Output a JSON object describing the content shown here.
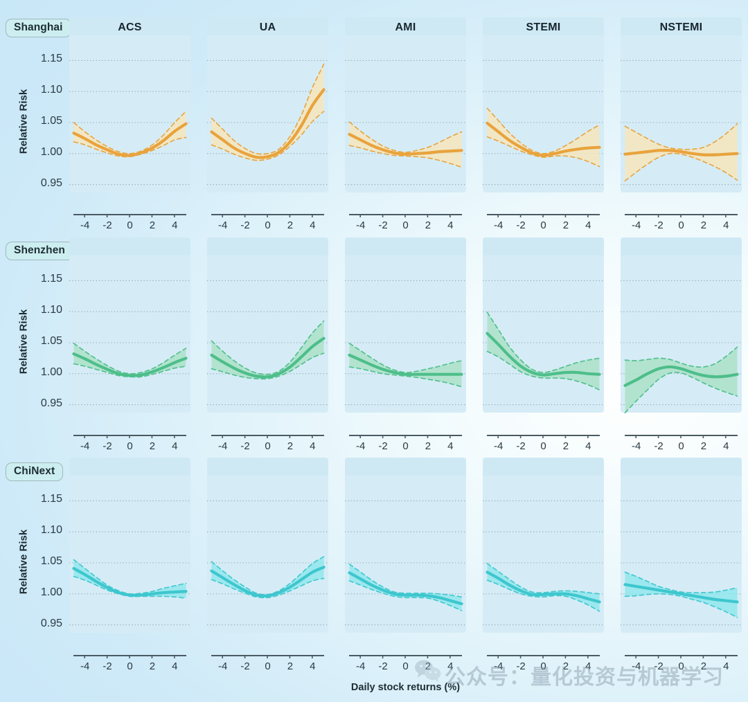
{
  "figure": {
    "xlabel": "Daily stock returns (%)",
    "ylabel": "Relative Risk",
    "watermark_text": "公众号：量化投资与机器学习",
    "watermark_icon": "wechat-icon"
  },
  "rows": [
    {
      "label": "Shanghai",
      "color": "#e8a33d",
      "band": "#f7e5ba"
    },
    {
      "label": "Shenzhen",
      "color": "#4dbe8a",
      "band": "#a9e0c6"
    },
    {
      "label": "ChiNext",
      "color": "#3ec6ce",
      "band": "#8de6ec"
    }
  ],
  "columns": [
    "ACS",
    "UA",
    "AMI",
    "STEMI",
    "NSTEMI"
  ],
  "axes": {
    "yticks": [
      "1.15",
      "1.10",
      "1.05",
      "1.00",
      "0.95"
    ],
    "ytick_values": [
      1.15,
      1.1,
      1.05,
      1.0,
      0.95
    ],
    "ylim": [
      0.925,
      1.175
    ],
    "xticks": [
      "-4",
      "-2",
      "0",
      "2",
      "4"
    ],
    "xtick_values": [
      -4,
      -2,
      0,
      2,
      4
    ],
    "xlim": [
      -5.4,
      5.4
    ],
    "grid": "horizontal-dotted"
  },
  "chart_data": {
    "type": "line",
    "title": "",
    "xlabel": "Daily stock returns (%)",
    "ylabel": "Relative Risk",
    "xlim": [
      -5.4,
      5.4
    ],
    "ylim": [
      0.925,
      1.175
    ],
    "row_facets": [
      "Shanghai",
      "Shenzhen",
      "ChiNext"
    ],
    "col_facets": [
      "ACS",
      "UA",
      "AMI",
      "STEMI",
      "NSTEMI"
    ],
    "x": [
      -5.0,
      -4.0,
      -3.0,
      -2.0,
      -1.0,
      0.0,
      1.0,
      2.0,
      3.0,
      4.0,
      5.0
    ],
    "panels": [
      {
        "row": "Shanghai",
        "col": "ACS",
        "color": "#e8a33d",
        "fit": [
          1.033,
          1.024,
          1.014,
          1.006,
          0.999,
          0.997,
          1.001,
          1.009,
          1.021,
          1.036,
          1.048
        ],
        "lower": [
          1.019,
          1.014,
          1.007,
          1.001,
          0.996,
          0.995,
          0.999,
          1.005,
          1.013,
          1.022,
          1.026
        ],
        "upper": [
          1.05,
          1.035,
          1.022,
          1.011,
          1.003,
          1.0,
          1.004,
          1.014,
          1.03,
          1.05,
          1.068
        ]
      },
      {
        "row": "Shanghai",
        "col": "UA",
        "color": "#e8a33d",
        "fit": [
          1.035,
          1.022,
          1.009,
          1.0,
          0.994,
          0.995,
          1.002,
          1.019,
          1.045,
          1.078,
          1.103
        ],
        "lower": [
          1.014,
          1.007,
          0.999,
          0.993,
          0.989,
          0.991,
          0.998,
          1.012,
          1.03,
          1.052,
          1.068
        ],
        "upper": [
          1.057,
          1.039,
          1.021,
          1.008,
          1.0,
          1.0,
          1.007,
          1.028,
          1.062,
          1.107,
          1.144
        ]
      },
      {
        "row": "Shanghai",
        "col": "AMI",
        "color": "#e8a33d",
        "fit": [
          1.031,
          1.022,
          1.013,
          1.006,
          1.001,
          0.999,
          1.0,
          1.001,
          1.003,
          1.004,
          1.005
        ],
        "lower": [
          1.013,
          1.009,
          1.004,
          1.0,
          0.997,
          0.996,
          0.995,
          0.993,
          0.989,
          0.984,
          0.978
        ],
        "upper": [
          1.051,
          1.036,
          1.023,
          1.012,
          1.005,
          1.002,
          1.005,
          1.01,
          1.018,
          1.027,
          1.035
        ]
      },
      {
        "row": "Shanghai",
        "col": "STEMI",
        "color": "#e8a33d",
        "fit": [
          1.049,
          1.035,
          1.021,
          1.01,
          1.001,
          0.997,
          1.0,
          1.004,
          1.007,
          1.009,
          1.01
        ],
        "lower": [
          1.027,
          1.02,
          1.012,
          1.004,
          0.998,
          0.994,
          0.996,
          0.996,
          0.993,
          0.987,
          0.979
        ],
        "upper": [
          1.073,
          1.053,
          1.033,
          1.017,
          1.005,
          1.0,
          1.004,
          1.013,
          1.024,
          1.036,
          1.046
        ]
      },
      {
        "row": "Shanghai",
        "col": "NSTEMI",
        "color": "#e8a33d",
        "fit": [
          0.999,
          1.001,
          1.003,
          1.005,
          1.005,
          1.003,
          1.0,
          0.998,
          0.998,
          0.999,
          1.0
        ],
        "lower": [
          0.956,
          0.97,
          0.983,
          0.994,
          1.0,
          0.999,
          0.994,
          0.987,
          0.979,
          0.969,
          0.957
        ],
        "upper": [
          1.044,
          1.034,
          1.024,
          1.015,
          1.009,
          1.007,
          1.007,
          1.01,
          1.019,
          1.032,
          1.048
        ]
      },
      {
        "row": "Shenzhen",
        "col": "ACS",
        "color": "#4dbe8a",
        "fit": [
          1.032,
          1.024,
          1.015,
          1.007,
          1.0,
          0.997,
          0.998,
          1.003,
          1.01,
          1.018,
          1.025
        ],
        "lower": [
          1.016,
          1.012,
          1.007,
          1.002,
          0.997,
          0.995,
          0.995,
          0.999,
          1.004,
          1.009,
          1.012
        ],
        "upper": [
          1.049,
          1.036,
          1.024,
          1.013,
          1.004,
          1.0,
          1.002,
          1.008,
          1.018,
          1.03,
          1.041
        ]
      },
      {
        "row": "Shenzhen",
        "col": "UA",
        "color": "#4dbe8a",
        "fit": [
          1.03,
          1.019,
          1.009,
          1.001,
          0.996,
          0.995,
          1.0,
          1.011,
          1.027,
          1.044,
          1.057
        ],
        "lower": [
          1.008,
          1.003,
          0.998,
          0.994,
          0.992,
          0.992,
          0.996,
          1.004,
          1.015,
          1.026,
          1.033
        ],
        "upper": [
          1.053,
          1.036,
          1.021,
          1.009,
          1.001,
          0.999,
          1.004,
          1.019,
          1.042,
          1.066,
          1.085
        ]
      },
      {
        "row": "Shenzhen",
        "col": "AMI",
        "color": "#4dbe8a",
        "fit": [
          1.03,
          1.022,
          1.014,
          1.007,
          1.002,
          0.999,
          0.999,
          0.999,
          0.999,
          0.999,
          0.999
        ],
        "lower": [
          1.011,
          1.008,
          1.004,
          1.0,
          0.998,
          0.996,
          0.994,
          0.991,
          0.988,
          0.984,
          0.979
        ],
        "upper": [
          1.049,
          1.037,
          1.025,
          1.014,
          1.006,
          1.002,
          1.004,
          1.008,
          1.012,
          1.017,
          1.021
        ]
      },
      {
        "row": "Shenzhen",
        "col": "STEMI",
        "color": "#4dbe8a",
        "fit": [
          1.065,
          1.047,
          1.028,
          1.012,
          1.002,
          0.998,
          1.0,
          1.002,
          1.002,
          1.0,
          0.999
        ],
        "lower": [
          1.036,
          1.027,
          1.015,
          1.003,
          0.996,
          0.993,
          0.993,
          0.992,
          0.988,
          0.982,
          0.974
        ],
        "upper": [
          1.099,
          1.071,
          1.043,
          1.022,
          1.007,
          1.002,
          1.006,
          1.012,
          1.018,
          1.022,
          1.025
        ]
      },
      {
        "row": "Shenzhen",
        "col": "NSTEMI",
        "color": "#4dbe8a",
        "fit": [
          0.981,
          0.99,
          1.0,
          1.008,
          1.011,
          1.008,
          1.002,
          0.997,
          0.995,
          0.996,
          0.999
        ],
        "lower": [
          0.937,
          0.956,
          0.974,
          0.991,
          1.001,
          1.001,
          0.994,
          0.985,
          0.977,
          0.97,
          0.964
        ],
        "upper": [
          1.022,
          1.021,
          1.023,
          1.025,
          1.023,
          1.017,
          1.012,
          1.011,
          1.016,
          1.028,
          1.043
        ]
      },
      {
        "row": "ChiNext",
        "col": "ACS",
        "color": "#3ec6ce",
        "fit": [
          1.041,
          1.031,
          1.02,
          1.01,
          1.002,
          0.998,
          0.998,
          1.0,
          1.002,
          1.003,
          1.004
        ],
        "lower": [
          1.028,
          1.022,
          1.014,
          1.006,
          1.0,
          0.996,
          0.996,
          0.996,
          0.996,
          0.995,
          0.993
        ],
        "upper": [
          1.055,
          1.041,
          1.027,
          1.014,
          1.005,
          1.0,
          1.001,
          1.004,
          1.009,
          1.013,
          1.017
        ]
      },
      {
        "row": "ChiNext",
        "col": "UA",
        "color": "#3ec6ce",
        "fit": [
          1.037,
          1.026,
          1.015,
          1.005,
          0.998,
          0.997,
          1.002,
          1.011,
          1.023,
          1.035,
          1.043
        ],
        "lower": [
          1.023,
          1.016,
          1.008,
          1.001,
          0.995,
          0.994,
          0.998,
          1.005,
          1.013,
          1.021,
          1.025
        ],
        "upper": [
          1.052,
          1.037,
          1.023,
          1.011,
          1.001,
          0.999,
          1.005,
          1.017,
          1.033,
          1.049,
          1.06
        ]
      },
      {
        "row": "ChiNext",
        "col": "AMI",
        "color": "#3ec6ce",
        "fit": [
          1.034,
          1.024,
          1.014,
          1.006,
          1.0,
          0.998,
          0.998,
          0.997,
          0.994,
          0.989,
          0.984
        ],
        "lower": [
          1.021,
          1.014,
          1.007,
          1.001,
          0.996,
          0.994,
          0.994,
          0.993,
          0.988,
          0.981,
          0.973
        ],
        "upper": [
          1.048,
          1.035,
          1.022,
          1.011,
          1.003,
          1.001,
          1.001,
          1.001,
          1.0,
          0.998,
          0.995
        ]
      },
      {
        "row": "ChiNext",
        "col": "STEMI",
        "color": "#3ec6ce",
        "fit": [
          1.035,
          1.025,
          1.014,
          1.005,
          0.999,
          0.999,
          1.0,
          1.0,
          0.997,
          0.992,
          0.987
        ],
        "lower": [
          1.022,
          1.015,
          1.007,
          1.0,
          0.996,
          0.995,
          0.997,
          0.996,
          0.99,
          0.982,
          0.972
        ],
        "upper": [
          1.049,
          1.036,
          1.023,
          1.011,
          1.003,
          1.002,
          1.004,
          1.005,
          1.004,
          1.002,
          1.0
        ]
      },
      {
        "row": "ChiNext",
        "col": "NSTEMI",
        "color": "#3ec6ce",
        "fit": [
          1.015,
          1.012,
          1.009,
          1.006,
          1.003,
          1.0,
          0.997,
          0.994,
          0.991,
          0.989,
          0.987
        ],
        "lower": [
          0.996,
          0.997,
          0.999,
          1.0,
          0.999,
          0.996,
          0.991,
          0.986,
          0.979,
          0.971,
          0.962
        ],
        "upper": [
          1.035,
          1.028,
          1.02,
          1.012,
          1.007,
          1.003,
          1.002,
          1.002,
          1.003,
          1.006,
          1.01
        ]
      }
    ]
  }
}
